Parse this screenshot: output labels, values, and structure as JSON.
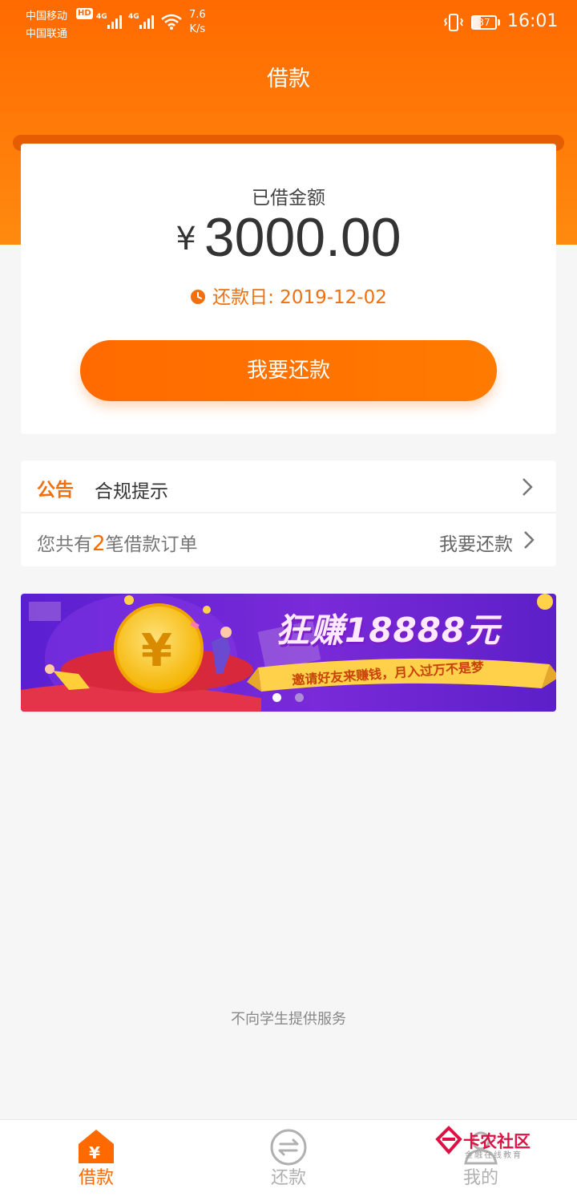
{
  "status_bar": {
    "carrier_1": "中国移动",
    "carrier_2": "中国联通",
    "hd": "HD",
    "net_speed_value": "7.6",
    "net_speed_unit": "K/s",
    "battery": "37",
    "time": "16:01"
  },
  "header": {
    "title": "借款"
  },
  "loan_card": {
    "borrowed_label": "已借金额",
    "currency_symbol": "¥",
    "amount": "3000.00",
    "due_date_text": "还款日: 2019-12-02",
    "repay_button_label": "我要还款"
  },
  "notice": {
    "tag": "公告",
    "text": "合规提示"
  },
  "orders": {
    "prefix": "您共有",
    "count": "2",
    "suffix": "笔借款订单",
    "link_label": "我要还款"
  },
  "banner": {
    "headline": "狂赚18888元",
    "subtext": "邀请好友来赚钱，月入过万不是梦",
    "slides_total": 2,
    "active_slide": 1
  },
  "footer_note": "不向学生提供服务",
  "tabbar": {
    "tabs": [
      {
        "label": "借款",
        "icon": "house-yuan-icon",
        "active": true
      },
      {
        "label": "还款",
        "icon": "exchange-arrows-icon",
        "active": false
      },
      {
        "label": "我的",
        "icon": "user-icon",
        "active": false
      }
    ]
  },
  "watermark": {
    "main": "卡农社区",
    "sub": "金融在线教育"
  },
  "colors": {
    "accent": "#ff6a00",
    "accent_text": "#f07010",
    "background": "#f6f6f6"
  }
}
